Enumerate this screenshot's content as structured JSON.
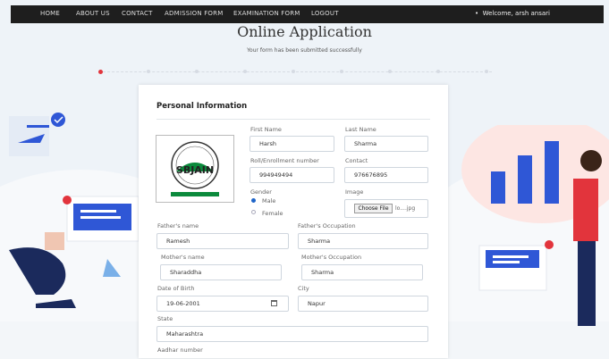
{
  "nav": {
    "items": [
      "HOME",
      "ABOUT US",
      "CONTACT",
      "ADMISSION FORM",
      "EXAMINATION FORM",
      "LOGOUT"
    ],
    "welcome": "Welcome, arsh ansari"
  },
  "hero": {
    "title": "Online Application",
    "subtitle": "Your form has been submitted successfully"
  },
  "stepper": {
    "total_steps": 9,
    "current_step": 1
  },
  "form": {
    "section_title": "Personal Information",
    "logo_text": "SBJAIN",
    "first_name": {
      "label": "First Name",
      "value": "Harsh"
    },
    "last_name": {
      "label": "Last Name",
      "value": "Sharma"
    },
    "roll": {
      "label": "Roll/Enrollment number",
      "value": "994949494"
    },
    "contact": {
      "label": "Contact",
      "value": "976676895"
    },
    "gender": {
      "label": "Gender",
      "options": [
        "Male",
        "Female"
      ],
      "selected": "Male"
    },
    "image": {
      "label": "Image",
      "button": "Choose File",
      "filename": "lo....jpg"
    },
    "father_name": {
      "label": "Father's name",
      "value": "Ramesh"
    },
    "father_occ": {
      "label": "Father's Occupation",
      "value": "Sharma"
    },
    "mother_name": {
      "label": "Mother's name",
      "value": "Sharaddha"
    },
    "mother_occ": {
      "label": "Mother's Occupation",
      "value": "Sharma"
    },
    "dob": {
      "label": "Date of Birth",
      "value": "19-06-2001"
    },
    "city": {
      "label": "City",
      "value": "Napur"
    },
    "state": {
      "label": "State",
      "value": "Maharashtra"
    },
    "aadhar": {
      "label": "Aadhar number"
    }
  },
  "colors": {
    "nav_bg": "#1e1e1e",
    "accent_red": "#e2343c",
    "radio_blue": "#1e64c8",
    "illustration_blue": "#2f57d6"
  }
}
